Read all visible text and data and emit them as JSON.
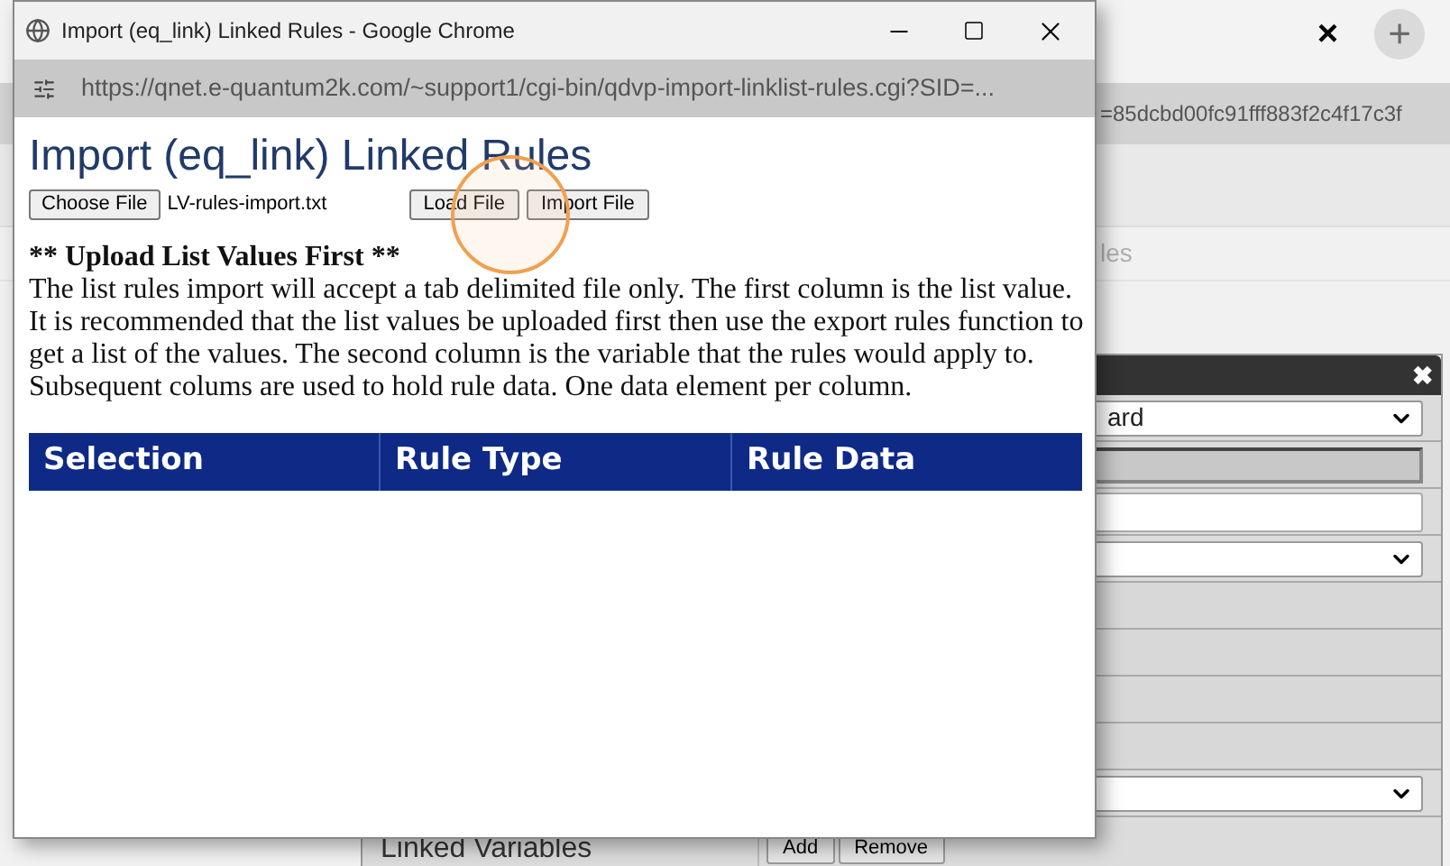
{
  "browser": {
    "tab_close": "×",
    "new_tab": "+",
    "address_tail": "=85dcbd00fc91fff883f2c4f17c3f"
  },
  "background_page": {
    "faint_label": "les",
    "dialog": {
      "close": "✖",
      "rows": [
        {
          "kind": "select",
          "value": "ard"
        },
        {
          "kind": "readonly"
        },
        {
          "kind": "input"
        },
        {
          "kind": "select",
          "value": ""
        },
        {
          "kind": "blank"
        },
        {
          "kind": "blank"
        },
        {
          "kind": "blank"
        },
        {
          "kind": "blank"
        },
        {
          "kind": "select",
          "value": ""
        },
        {
          "kind": "buttons",
          "label": "Linked Variables",
          "buttons": [
            "Add",
            "Remove"
          ]
        }
      ]
    }
  },
  "popup": {
    "window_title": "Import (eq_link) Linked Rules - Google Chrome",
    "url": "https://qnet.e-quantum2k.com/~support1/cgi-bin/qdvp-import-linklist-rules.cgi?SID=...",
    "heading": "Import (eq_link) Linked Rules",
    "choose_file": "Choose File",
    "file_name": "LV-rules-import.txt",
    "buttons": [
      "Load File",
      "Import File"
    ],
    "notice_title": "** Upload List Values First **",
    "notice": "The list rules import will accept a tab delimited file only. The first column is the list value. It is recommended that the list values be uploaded first then use the export rules function to get a list of the values. The second column is the variable that the rules would apply to. Subsequent colums are used to hold rule data. One data element per column.",
    "table": {
      "columns": [
        "Selection",
        "Rule Type",
        "Rule Data"
      ]
    }
  }
}
